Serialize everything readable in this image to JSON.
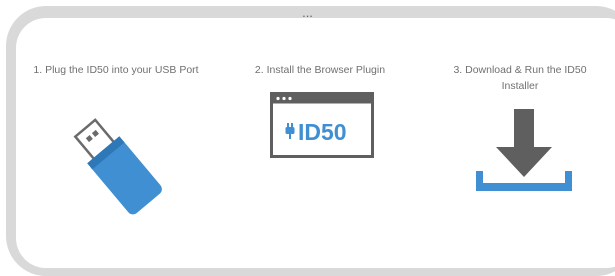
{
  "heading_partial": "...",
  "steps": [
    {
      "label": "1. Plug the ID50 into your USB Port",
      "icon": "usb-stick-icon"
    },
    {
      "label": "2. Install the Browser Plugin",
      "icon": "browser-plugin-icon",
      "icon_text": "ID50"
    },
    {
      "label": "3. Download & Run the ID50 Installer",
      "icon": "download-icon"
    }
  ],
  "colors": {
    "blue": "#3f8fd2",
    "gray_dark": "#5f5f5f",
    "frame": "#d9d9d9"
  }
}
